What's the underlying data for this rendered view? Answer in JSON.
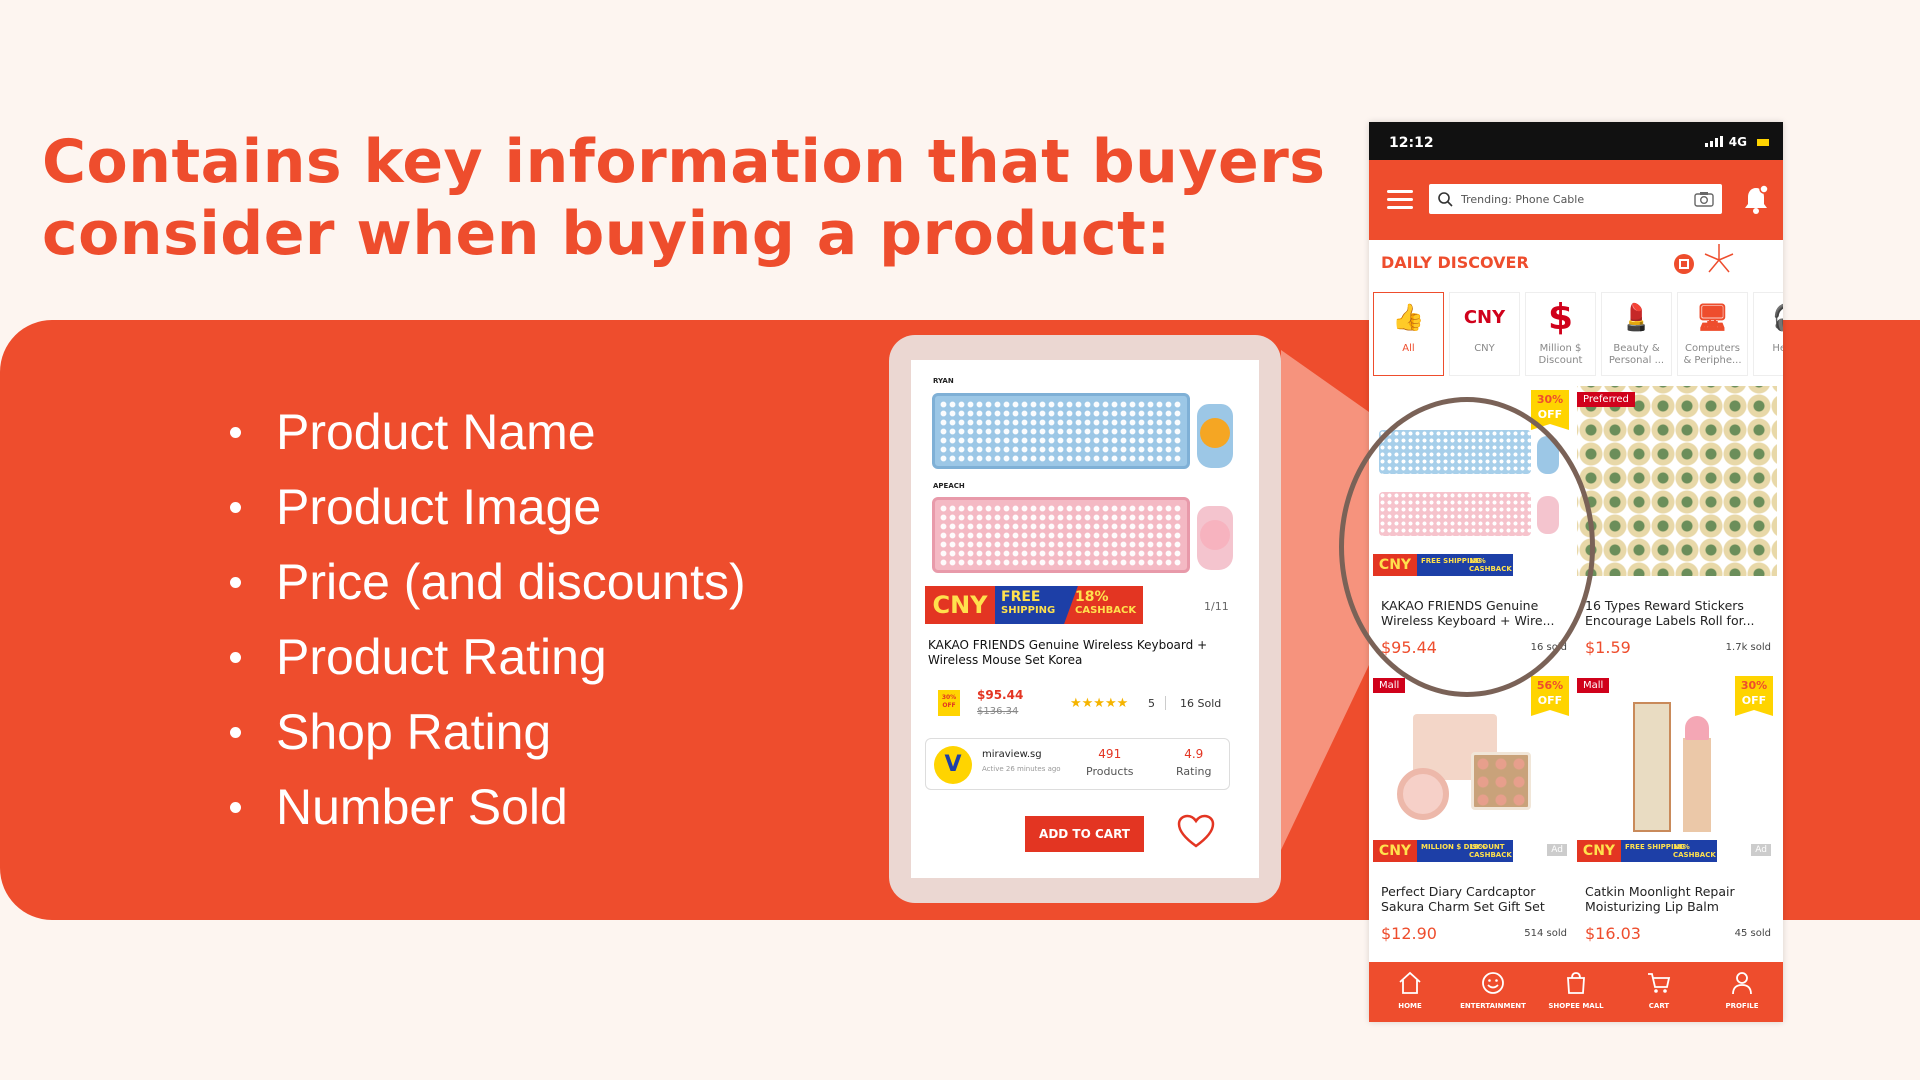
{
  "headline": "Contains key information that buyers consider when buying a product:",
  "bullets": [
    "Product Name",
    "Product Image",
    "Price (and discounts)",
    "Product Rating",
    "Shop Rating",
    "Number Sold"
  ],
  "callout": {
    "label_top": "RYAN",
    "label_bottom": "APEACH",
    "cny": "CNY",
    "free": "FREE",
    "shipping": "SHIPPING",
    "cashback_pct": "18%",
    "cashback": "CASHBACK",
    "pager": "1/11",
    "title": "KAKAO FRIENDS Genuine Wireless Keyboard + Wireless Mouse Set Korea",
    "off_pct": "30%",
    "off": "OFF",
    "price": "$95.44",
    "old_price": "$136.34",
    "stars": "★★★★★",
    "rating": "5",
    "sold": "16 Sold",
    "shop_name": "miraview.sg",
    "shop_active": "Active 26 minutes ago",
    "products_value": "491",
    "products_label": "Products",
    "rating_value": "4.9",
    "rating_label": "Rating",
    "add_to_cart": "ADD TO CART"
  },
  "phone": {
    "time": "12:12",
    "network": "4G",
    "search_placeholder": "Trending: Phone Cable",
    "daily_discover": "DAILY DISCOVER",
    "categories": [
      {
        "icon": "👍",
        "label": "All"
      },
      {
        "icon": "CNY",
        "label": "CNY"
      },
      {
        "icon": "$",
        "label": "Million $ Discount"
      },
      {
        "icon": "💄",
        "label": "Beauty & Personal ..."
      },
      {
        "icon": "🖥",
        "label": "Computers & Periphe..."
      },
      {
        "icon": "🎧",
        "label": "He We"
      }
    ],
    "products": [
      {
        "name": "KAKAO FRIENDS Genuine Wireless Keyboard + Wire...",
        "price": "$95.44",
        "sold": "16 sold",
        "off_pct": "30%",
        "off": "OFF",
        "badge": "",
        "cny_a": "CNY",
        "cny_b": "FREE SHIPPING",
        "cny_c": "18% CASHBACK",
        "ad": ""
      },
      {
        "name": "16 Types Reward Stickers Encourage Labels Roll for...",
        "price": "$1.59",
        "sold": "1.7k sold",
        "off_pct": "",
        "off": "",
        "badge": "Preferred",
        "cny_a": "",
        "cny_b": "",
        "cny_c": "",
        "ad": ""
      },
      {
        "name": "Perfect Diary Cardcaptor Sakura Charm Set Gift Set",
        "price": "$12.90",
        "sold": "514 sold",
        "off_pct": "56%",
        "off": "OFF",
        "badge": "Mall",
        "cny_a": "CNY",
        "cny_b": "MILLION $ DISCOUNT",
        "cny_c": "18% CASHBACK",
        "ad": "Ad"
      },
      {
        "name": "Catkin Moonlight Repair Moisturizing Lip Balm",
        "price": "$16.03",
        "sold": "45 sold",
        "off_pct": "30%",
        "off": "OFF",
        "badge": "Mall",
        "cny_a": "CNY",
        "cny_b": "FREE SHIPPING",
        "cny_c": "18% CASHBACK",
        "ad": "Ad"
      }
    ],
    "nav": [
      "HOME",
      "ENTERTAINMENT",
      "SHOPEE MALL",
      "CART",
      "PROFILE"
    ]
  },
  "colors": {
    "brand": "#EE4D2D",
    "background": "#FDF5F0",
    "circle": "#7A6257"
  }
}
